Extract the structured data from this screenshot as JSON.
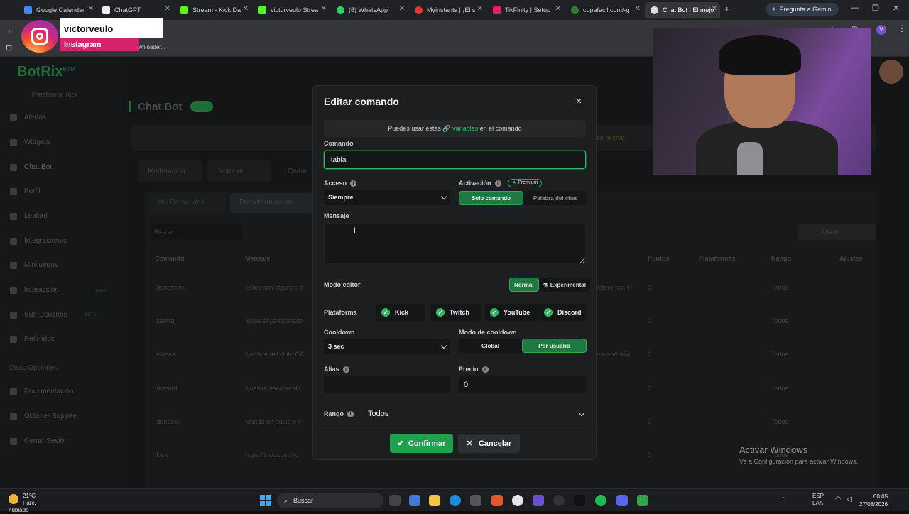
{
  "browser": {
    "tabs": [
      {
        "label": "Google Calendar",
        "color": "#4285f4"
      },
      {
        "label": "ChatGPT",
        "color": "#ffffff"
      },
      {
        "label": "Stream - Kick Da",
        "color": "#53fc18"
      },
      {
        "label": "victorveulo Strea",
        "color": "#53fc18"
      },
      {
        "label": "(6) WhatsApp",
        "color": "#25d366"
      },
      {
        "label": "Myinstants | ¡El s",
        "color": "#e53935"
      },
      {
        "label": "TikFinity | Setup",
        "color": "#e91e63"
      },
      {
        "label": "copafacil.com/-g",
        "color": "#2e7d32"
      },
      {
        "label": "Chat Bot | El mejo",
        "color": "#ffffff"
      }
    ],
    "gemini_label": "Pregunta a Gemini",
    "bookmark_text": "age downloader..."
  },
  "instagram": {
    "username": "victorveulo",
    "label": "Instagram"
  },
  "background_page": {
    "logo": "BotRix",
    "logo_badge": "BETA",
    "platform_label": "Plataforma: Kick",
    "nav": [
      "Alertas",
      "Widgets",
      "Chat Bot",
      "Perfil",
      "Lealtad",
      "Integraciones",
      "Minijuegos",
      "Interacción",
      "Sub-Usuarios",
      "Referidos"
    ],
    "nav_badge": "nuevo",
    "nav_badge2": "BETA",
    "other_options": "Otras Opciones",
    "nav2": [
      "Documentación",
      "Obtener Soporte",
      "Cerrar Sesión"
    ],
    "page_title": "Chat Bot",
    "notice_text": "en tu chat.",
    "tabs": [
      "Moderación",
      "Nombre",
      "Coma"
    ],
    "subtabs": [
      "Mis Comandos",
      "Predeterminados"
    ],
    "search_placeholder": "Buscar...",
    "add_button": "Añadir",
    "columns": [
      "Comando",
      "Mensaje",
      "Puntos",
      "Plataformas",
      "Rango",
      "Ajustes"
    ],
    "rows": [
      {
        "cmd": "!beneficios",
        "msg": "Estos son algunos d",
        "extra": "referencia en",
        "points": "0",
        "rank": "Todos"
      },
      {
        "cmd": "!central",
        "msg": "Sigue al patrocinado",
        "extra": "",
        "points": "0",
        "rank": "Todos"
      },
      {
        "cmd": "!clubes",
        "msg": "Nombre del club: CA",
        "extra": "p.com/LA7k",
        "points": "0",
        "rank": "Todos"
      },
      {
        "cmd": "!discord",
        "msg": "Nuestro servidor de",
        "extra": "",
        "points": "0",
        "rank": "Todos"
      },
      {
        "cmd": "!donoclip",
        "msg": "Manda un audio o v",
        "extra": "",
        "points": "0",
        "rank": "Todos"
      },
      {
        "cmd": "!kick",
        "msg": "https://kick.com/vic",
        "extra": "",
        "points": "0",
        "rank": "Todos"
      }
    ]
  },
  "modal": {
    "title": "Editar comando",
    "close": "×",
    "banner_pre": "Puedes usar estas",
    "banner_link": "variables",
    "banner_post": "en el comando",
    "command_label": "Comando",
    "command_value": "!tabla",
    "access_label": "Acceso",
    "access_value": "Siempre",
    "activation_label": "Activación",
    "premium_label": "Premium",
    "activation_options": [
      "Solo comando",
      "Palabra del chat"
    ],
    "message_label": "Mensaje",
    "message_value": "",
    "editor_label": "Modo editor",
    "editor_options": [
      "Normal",
      "Experimental"
    ],
    "platform_label": "Plataforma",
    "platforms": [
      "Kick",
      "Twitch",
      "YouTube",
      "Discord"
    ],
    "cooldown_label": "Cooldown",
    "cooldown_value": "3 sec",
    "cooldown_mode_label": "Modo de cooldown",
    "cooldown_mode_options": [
      "Global",
      "Por usuario"
    ],
    "alias_label": "Alias",
    "alias_value": "",
    "price_label": "Precio",
    "price_value": "0",
    "rank_label": "Rango",
    "rank_value": "Todos",
    "confirm": "Confirmar",
    "cancel": "Cancelar",
    "accent": "#21a04d"
  },
  "windows": {
    "activate_title": "Activar Windows",
    "activate_sub": "Ve a Configuración para activar Windows.",
    "weather_temp": "21°C",
    "weather_desc": "Parc. nublado",
    "search_label": "Buscar",
    "lang": "ESP",
    "lang2": "LAA",
    "time": "00:05",
    "date": "27/08/2026"
  }
}
